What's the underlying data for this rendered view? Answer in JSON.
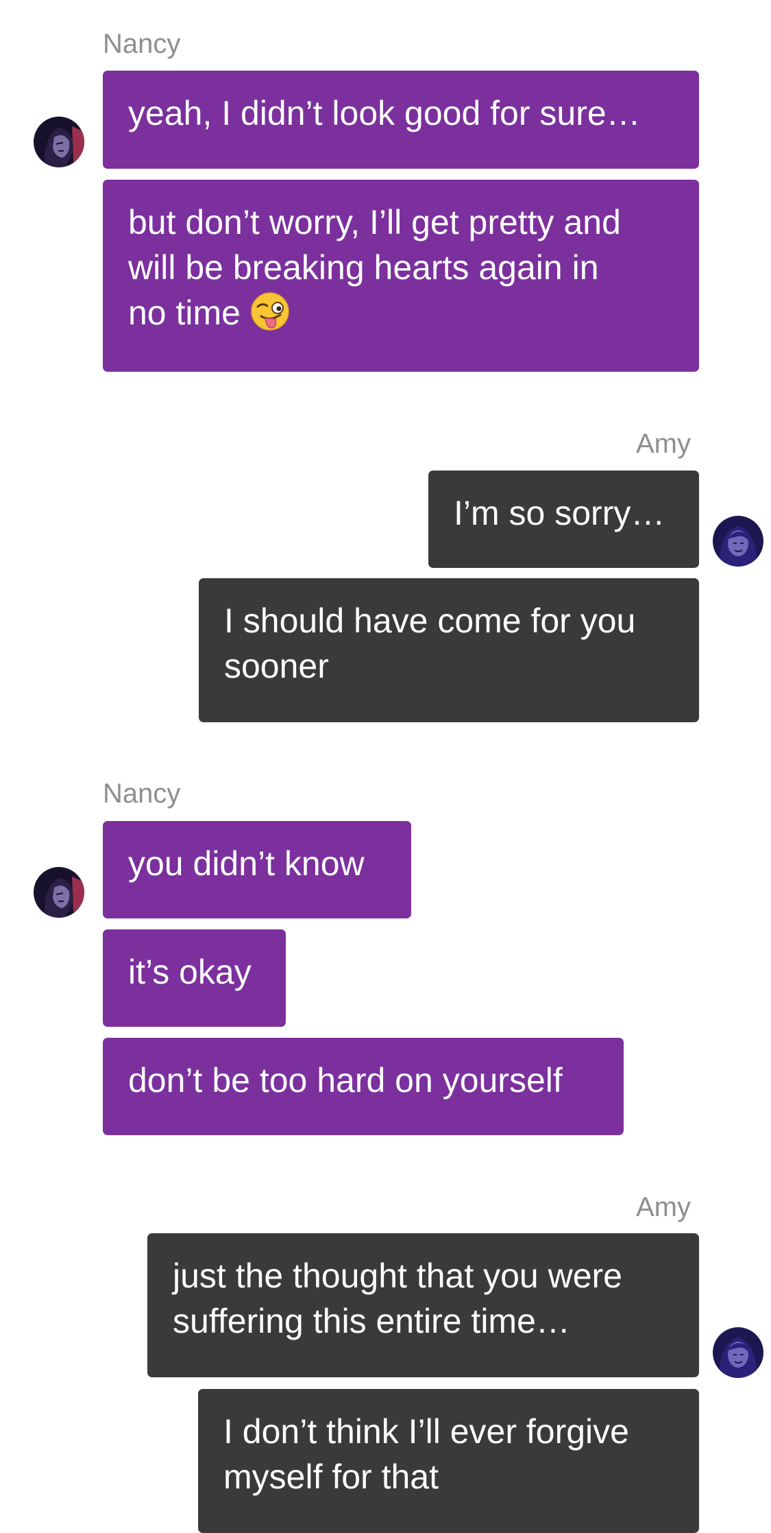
{
  "groups": [
    {
      "sender": "Nancy",
      "side": "left",
      "avatar_icon": "nancy-avatar",
      "messages": [
        {
          "lines": [
            "yeah, I didn’t look good for sure…"
          ]
        },
        {
          "lines": [
            "but don’t worry, I’ll get pretty and",
            "will be breaking hearts again in",
            "no time "
          ],
          "emoji": "winking-face-with-tongue"
        }
      ]
    },
    {
      "sender": "Amy",
      "side": "right",
      "avatar_icon": "amy-avatar",
      "messages": [
        {
          "lines": [
            "I’m so sorry…"
          ]
        },
        {
          "lines": [
            "I should have come for you",
            "sooner"
          ]
        }
      ]
    },
    {
      "sender": "Nancy",
      "side": "left",
      "avatar_icon": "nancy-avatar",
      "messages": [
        {
          "lines": [
            "you didn’t know"
          ]
        },
        {
          "lines": [
            "it’s okay"
          ]
        },
        {
          "lines": [
            "don’t be too hard on yourself"
          ]
        }
      ]
    },
    {
      "sender": "Amy",
      "side": "right",
      "avatar_icon": "amy-avatar",
      "messages": [
        {
          "lines": [
            "just the thought that you were",
            "suffering this entire time…"
          ]
        },
        {
          "lines": [
            "I don’t think I’ll ever forgive",
            "myself for that"
          ]
        }
      ]
    }
  ],
  "colors": {
    "nancy_bubble": "#7b309d",
    "amy_bubble": "#3a3a3a",
    "sender_name": "#8e8e93",
    "background": "#ffffff"
  }
}
